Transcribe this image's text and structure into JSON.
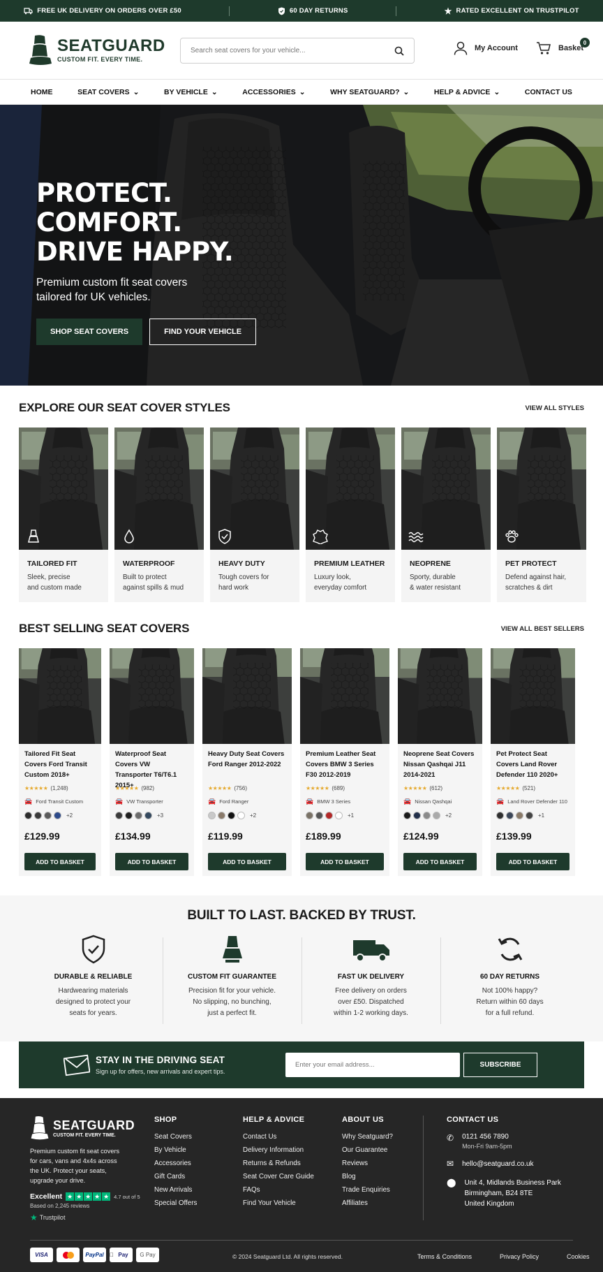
{
  "topbar": {
    "delivery": "FREE UK DELIVERY ON ORDERS OVER £50",
    "returns": "60 DAY RETURNS",
    "trustpilot": "RATED EXCELLENT ON TRUSTPILOT"
  },
  "header": {
    "brand": "SEATGUARD",
    "tagline": "CUSTOM FIT. EVERY TIME.",
    "search_placeholder": "Search seat covers for your vehicle...",
    "account": "My Account",
    "basket": "Basket",
    "basket_count": "0"
  },
  "nav": [
    "HOME",
    "SEAT COVERS",
    "BY VEHICLE",
    "ACCESSORIES",
    "WHY SEATGUARD?",
    "HELP & ADVICE",
    "CONTACT US"
  ],
  "hero": {
    "line1": "PROTECT.",
    "line2": "COMFORT.",
    "line3": "DRIVE HAPPY.",
    "subtitle": "Premium custom fit seat covers tailored for UK vehicles.",
    "cta_primary": "SHOP SEAT COVERS",
    "cta_secondary": "FIND YOUR VEHICLE"
  },
  "styles": {
    "title": "EXPLORE OUR SEAT COVER STYLES",
    "view_all": "VIEW ALL STYLES",
    "items": [
      {
        "title": "TAILORED FIT",
        "desc1": "Sleek, precise",
        "desc2": "and custom made",
        "icon": "seat-icon"
      },
      {
        "title": "WATERPROOF",
        "desc1": "Built to protect",
        "desc2": "against spills & mud",
        "icon": "droplet-icon"
      },
      {
        "title": "HEAVY DUTY",
        "desc1": "Tough covers for",
        "desc2": "hard work",
        "icon": "shield-icon"
      },
      {
        "title": "PREMIUM LEATHER",
        "desc1": "Luxury look,",
        "desc2": "everyday comfort",
        "icon": "leather-hide-icon"
      },
      {
        "title": "NEOPRENE",
        "desc1": "Sporty, durable",
        "desc2": "& water resistant",
        "icon": "waves-icon"
      },
      {
        "title": "PET PROTECT",
        "desc1": "Defend against hair,",
        "desc2": "scratches & dirt",
        "icon": "paw-icon"
      }
    ]
  },
  "bestsellers": {
    "title": "BEST SELLING SEAT COVERS",
    "view_all": "VIEW ALL BEST SELLERS",
    "add": "ADD TO BASKET",
    "items": [
      {
        "name": "Tailored Fit Seat Covers Ford Transit Custom 2018+",
        "reviews": "(1,248)",
        "vehicle": "Ford Transit Custom",
        "more": "+2",
        "price": "£129.99",
        "swatches": [
          "#2b2b2b",
          "#3a3a3a",
          "#5a5a5a",
          "#2d4a8a"
        ]
      },
      {
        "name": "Waterproof Seat Covers VW Transporter T6/T6.1 2015+",
        "reviews": "(982)",
        "vehicle": "VW Transporter",
        "more": "+3",
        "price": "£134.99",
        "swatches": [
          "#3a3a3a",
          "#1e1e1e",
          "#6b6b6b",
          "#34495e"
        ]
      },
      {
        "name": "Heavy Duty Seat Covers Ford Ranger 2012-2022",
        "reviews": "(756)",
        "vehicle": "Ford Ranger",
        "more": "+2",
        "price": "£119.99",
        "swatches": [
          "#c9c9c9",
          "#8a7a6a",
          "#111111",
          "#ffffff"
        ]
      },
      {
        "name": "Premium Leather Seat Covers BMW 3 Series F30 2012-2019",
        "reviews": "(689)",
        "vehicle": "BMW 3 Series",
        "more": "+1",
        "price": "£189.99",
        "swatches": [
          "#7a7266",
          "#555555",
          "#b32828",
          "#ffffff"
        ]
      },
      {
        "name": "Neoprene Seat Covers Nissan Qashqai J11 2014-2021",
        "reviews": "(612)",
        "vehicle": "Nissan Qashqai",
        "more": "+2",
        "price": "£124.99",
        "swatches": [
          "#1a1a1a",
          "#22304a",
          "#8a8a8a",
          "#aaaaaa"
        ]
      },
      {
        "name": "Pet Protect Seat Covers Land Rover Defender 110 2020+",
        "reviews": "(521)",
        "vehicle": "Land Rover Defender 110",
        "more": "+1",
        "price": "£139.99",
        "swatches": [
          "#2e2e2e",
          "#3b4658",
          "#8a7a68",
          "#444444"
        ]
      }
    ]
  },
  "trust": {
    "title": "BUILT TO LAST. BACKED BY TRUST.",
    "items": [
      {
        "title": "DURABLE & RELIABLE",
        "l1": "Hardwearing materials",
        "l2": "designed to protect your",
        "l3": "seats for years."
      },
      {
        "title": "CUSTOM FIT GUARANTEE",
        "l1": "Precision fit for your vehicle.",
        "l2": "No slipping, no bunching,",
        "l3": "just a perfect fit."
      },
      {
        "title": "FAST UK DELIVERY",
        "l1": "Free delivery on orders",
        "l2": "over £50. Dispatched",
        "l3": "within 1-2 working days."
      },
      {
        "title": "60 DAY RETURNS",
        "l1": "Not 100% happy?",
        "l2": "Return within 60 days",
        "l3": "for a full refund."
      }
    ]
  },
  "newsletter": {
    "title": "STAY IN THE DRIVING SEAT",
    "subtitle": "Sign up for offers, new arrivals and expert tips.",
    "placeholder": "Enter your email address...",
    "button": "SUBSCRIBE"
  },
  "footer": {
    "brand": "SEATGUARD",
    "tagline": "CUSTOM FIT. EVERY TIME.",
    "about": [
      "Premium custom fit seat covers",
      "for cars, vans and 4x4s across",
      "the UK. Protect your seats,",
      "upgrade your drive."
    ],
    "tp_excellent": "Excellent",
    "tp_score": "4.7 out of 5",
    "tp_reviews": "Based on 2,245 reviews",
    "tp_brand": "Trustpilot",
    "shop_title": "SHOP",
    "shop": [
      "Seat Covers",
      "By Vehicle",
      "Accessories",
      "Gift Cards",
      "New Arrivals",
      "Special Offers"
    ],
    "help_title": "HELP & ADVICE",
    "help": [
      "Contact Us",
      "Delivery Information",
      "Returns & Refunds",
      "Seat Cover Care Guide",
      "FAQs",
      "Find Your Vehicle"
    ],
    "about_title": "ABOUT US",
    "about_links": [
      "Why Seatguard?",
      "Our Guarantee",
      "Reviews",
      "Blog",
      "Trade Enquiries",
      "Affiliates"
    ],
    "contact_title": "CONTACT US",
    "phone": "0121 456 7890",
    "hours": "Mon-Fri 9am-5pm",
    "email": "hello@seatguard.co.uk",
    "address": [
      "Unit 4, Midlands Business Park",
      "Birmingham, B24 8TE",
      "United Kingdom"
    ],
    "payments": [
      "VISA",
      "Mastercard",
      "PayPal",
      "Pay",
      "G Pay"
    ],
    "copyright": "© 2024 Seatguard Ltd. All rights reserved.",
    "legal": [
      "Terms & Conditions",
      "Privacy Policy",
      "Cookies"
    ]
  },
  "colors": {
    "brand_green": "#1e3a2c",
    "footer_bg": "#262626",
    "star": "#e5a92d",
    "trustpilot_green": "#00b67a"
  }
}
